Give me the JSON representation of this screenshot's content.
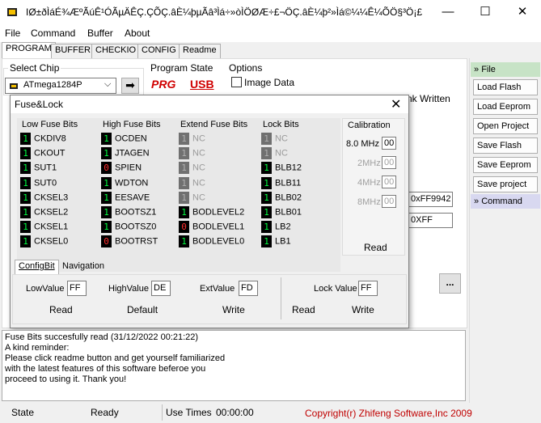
{
  "window": {
    "title": "IØ±ðÌáÉ¾ÆºÃúÊ¹ÓÃµÄÊÇ.ÇÕÇ.âÈ¼þµÃâ³Ìá÷»òÌÖØÆ÷£¬ÖÇ.âÈ¼þ²»Ìá©¼¼Ê¼ÕÖ§³Ö¡£"
  },
  "menu": [
    "File",
    "Command",
    "Buffer",
    "About"
  ],
  "tabs": [
    "PROGRAM",
    "BUFFER",
    "CHECKIO",
    "CONFIG",
    "Readme"
  ],
  "chip": {
    "label": "Select Chip",
    "value": "ATmega1284P"
  },
  "program_state": {
    "label": "Program State",
    "prg": "PRG",
    "usb": "USB"
  },
  "options": {
    "label": "Options",
    "image_data": "Image Data",
    "blank_written": "nk Written"
  },
  "peek": {
    "val1": "0xFF9942",
    "val2": "0XFF",
    "dots": "..."
  },
  "sidebar": {
    "file_header": "File",
    "buttons": [
      "Load Flash",
      "Load Eeprom",
      "Open Project",
      "Save Flash",
      "Save Eeprom",
      "Save project"
    ],
    "command_header": "Command"
  },
  "dialog": {
    "title": "Fuse&Lock",
    "columns": [
      {
        "header": "Low Fuse Bits",
        "rows": [
          {
            "bit": "1",
            "name": "CKDIV8"
          },
          {
            "bit": "1",
            "name": "CKOUT"
          },
          {
            "bit": "1",
            "name": "SUT1"
          },
          {
            "bit": "1",
            "name": "SUT0"
          },
          {
            "bit": "1",
            "name": "CKSEL3"
          },
          {
            "bit": "1",
            "name": "CKSEL2"
          },
          {
            "bit": "1",
            "name": "CKSEL1"
          },
          {
            "bit": "1",
            "name": "CKSEL0"
          }
        ]
      },
      {
        "header": "High Fuse Bits",
        "rows": [
          {
            "bit": "1",
            "name": "OCDEN"
          },
          {
            "bit": "1",
            "name": "JTAGEN"
          },
          {
            "bit": "0",
            "name": "SPIEN"
          },
          {
            "bit": "1",
            "name": "WDTON"
          },
          {
            "bit": "1",
            "name": "EESAVE"
          },
          {
            "bit": "1",
            "name": "BOOTSZ1"
          },
          {
            "bit": "1",
            "name": "BOOTSZ0"
          },
          {
            "bit": "0",
            "name": "BOOTRST"
          }
        ]
      },
      {
        "header": "Extend Fuse Bits",
        "rows": [
          {
            "bit": "1",
            "name": "NC",
            "disabled": true
          },
          {
            "bit": "1",
            "name": "NC",
            "disabled": true
          },
          {
            "bit": "1",
            "name": "NC",
            "disabled": true
          },
          {
            "bit": "1",
            "name": "NC",
            "disabled": true
          },
          {
            "bit": "1",
            "name": "NC",
            "disabled": true
          },
          {
            "bit": "1",
            "name": "BODLEVEL2"
          },
          {
            "bit": "0",
            "name": "BODLEVEL1"
          },
          {
            "bit": "1",
            "name": "BODLEVEL0"
          }
        ]
      },
      {
        "header": "Lock Bits",
        "rows": [
          {
            "bit": "1",
            "name": "NC",
            "disabled": true
          },
          {
            "bit": "1",
            "name": "NC",
            "disabled": true
          },
          {
            "bit": "1",
            "name": "BLB12"
          },
          {
            "bit": "1",
            "name": "BLB11"
          },
          {
            "bit": "1",
            "name": "BLB02"
          },
          {
            "bit": "1",
            "name": "BLB01"
          },
          {
            "bit": "1",
            "name": "LB2"
          },
          {
            "bit": "1",
            "name": "LB1"
          }
        ]
      }
    ],
    "calibration": {
      "header": "Calibration",
      "rows": [
        {
          "freq": "8.0 MHz",
          "value": "00",
          "enabled": true
        },
        {
          "freq": "2MHz",
          "value": "00",
          "enabled": false
        },
        {
          "freq": "4MHz",
          "value": "00",
          "enabled": false
        },
        {
          "freq": "8MHz",
          "value": "00",
          "enabled": false
        }
      ],
      "read": "Read"
    },
    "subtabs": [
      "ConfigBit",
      "Navigation"
    ],
    "low_value_label": "LowValue",
    "low_value": "FF",
    "high_value_label": "HighValue",
    "high_value": "DE",
    "ext_value_label": "ExtValue",
    "ext_value": "FD",
    "lock_value_label": "Lock Value",
    "lock_value": "FF",
    "read": "Read",
    "default": "Default",
    "write": "Write",
    "lock_read": "Read",
    "lock_write": "Write"
  },
  "log": [
    "Fuse Bits succesfully read (31/12/2022 00:21:22)",
    "A kind reminder:",
    "Please click readme button and get yourself familiarized",
    "with the latest features of this software beferoe you",
    "proceed to using it. Thank you!"
  ],
  "status": {
    "state_label": "State",
    "state_value": "Ready",
    "time_label": "Use Times",
    "time_value": "00:00:00",
    "copyright": "Copyright(r) Zhifeng Software,Inc 2009"
  },
  "colors": {
    "bit_one": "#00ff40",
    "bit_zero": "#ff3030",
    "prg_red": "#d00000",
    "copyright_red": "#c00000",
    "sidebar_header": "#c7e3c6"
  }
}
